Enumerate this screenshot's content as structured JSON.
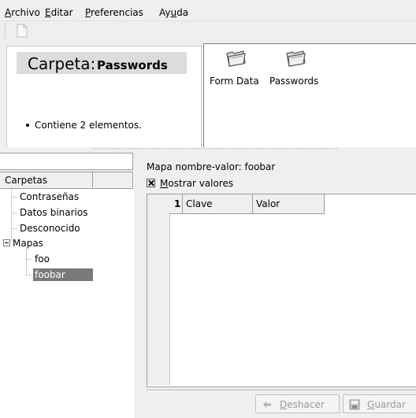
{
  "menubar": {
    "items": [
      {
        "label": "Archivo",
        "mnemonic": "A",
        "rest": "rchivo"
      },
      {
        "label": "Editar",
        "mnemonic": "E",
        "rest": "ditar"
      },
      {
        "label": "Preferencias",
        "mnemonic": "P",
        "rest": "referencias"
      },
      {
        "label": "Ayuda",
        "pre": "Ay",
        "mnemonic": "u",
        "rest": "da"
      }
    ]
  },
  "toolbar": {
    "new_icon": "new-document-icon"
  },
  "info": {
    "title_prefix": "Carpeta:",
    "title_name": "Passwords",
    "description": "Contiene 2 elementos."
  },
  "icon_view": {
    "items": [
      {
        "label": "Form Data",
        "icon": "folder-icon"
      },
      {
        "label": "Passwords",
        "icon": "folder-icon"
      }
    ]
  },
  "tree": {
    "search_value": "",
    "header": "Carpetas",
    "items": {
      "contrasenas": "Contraseñas",
      "datos_binarios": "Datos binarios",
      "desconocido": "Desconocido",
      "mapas": "Mapas",
      "foo": "foo",
      "foobar": "foobar"
    },
    "selected": "foobar"
  },
  "map": {
    "label": "Mapa nombre-valor: foobar",
    "show_values": {
      "mnemonic": "M",
      "rest": "ostrar valores",
      "checked": true
    },
    "table": {
      "row_number": "1",
      "columns": [
        "Clave",
        "Valor"
      ],
      "rows": []
    }
  },
  "buttons": {
    "undo": {
      "mnemonic": "D",
      "rest": "eshacer",
      "enabled": false
    },
    "save": {
      "mnemonic": "G",
      "rest": "uardar",
      "enabled": false
    }
  },
  "colors": {
    "selection": "#7a7a7a",
    "background": "#efefef"
  }
}
